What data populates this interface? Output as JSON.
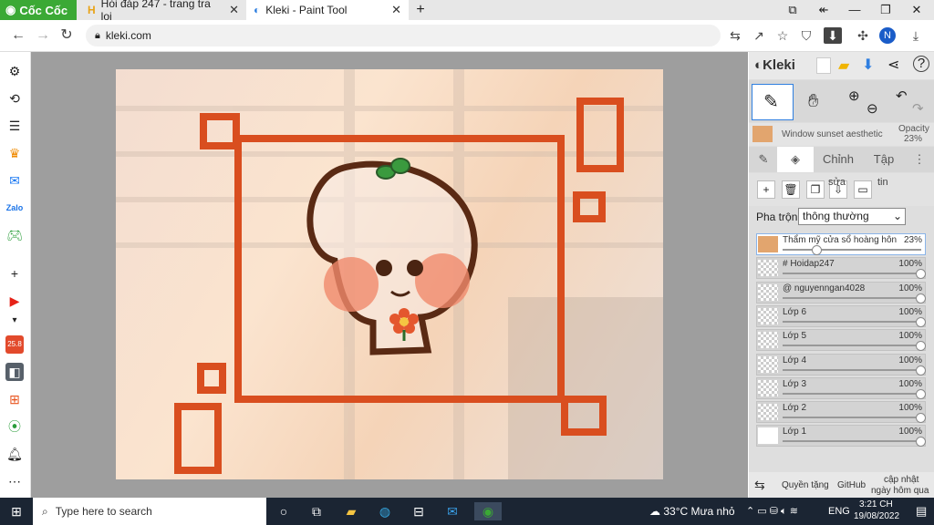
{
  "browser": {
    "brand": "Cốc Cốc",
    "tabs": [
      {
        "title": "Hỏi đáp 247 - trang tra loi"
      },
      {
        "title": "Kleki - Paint Tool"
      }
    ],
    "url": "kleki.com",
    "avatar_letter": "N"
  },
  "sidebar": {
    "badge": "25.8"
  },
  "kleki": {
    "logo": "Kleki",
    "brush_name": "Window sunset aesthetic",
    "opacity_label": "Opacity",
    "opacity_value": "23%",
    "tabs": [
      "Chỉnh",
      "Tập"
    ],
    "tab_extra_1": "sửa",
    "tab_extra_2": "tin",
    "blend_label": "Pha trộn",
    "blend_value": "thông thường",
    "layers": [
      {
        "name": "Thẩm mỹ cửa sổ hoàng hôn",
        "opacity": "23%",
        "level": 0.23
      },
      {
        "name": "# Hoidap247",
        "opacity": "100%",
        "level": 1
      },
      {
        "name": "@ nguyenngan4028",
        "opacity": "100%",
        "level": 1
      },
      {
        "name": "Lớp 6",
        "opacity": "100%",
        "level": 1
      },
      {
        "name": "Lớp 5",
        "opacity": "100%",
        "level": 1
      },
      {
        "name": "Lớp 4",
        "opacity": "100%",
        "level": 1
      },
      {
        "name": "Lớp 3",
        "opacity": "100%",
        "level": 1
      },
      {
        "name": "Lớp 2",
        "opacity": "100%",
        "level": 1
      },
      {
        "name": "Lớp 1",
        "opacity": "100%",
        "level": 1
      }
    ],
    "footer": {
      "privacy": "Quyền tặng",
      "github": "GitHub",
      "update_1": "cập nhật",
      "update_2": "ngày hôm qua"
    }
  },
  "taskbar": {
    "search_placeholder": "Type here to search",
    "weather": "33°C Mưa nhỏ",
    "lang": "ENG",
    "time": "3:21 CH",
    "date": "19/08/2022"
  },
  "colors": {
    "frame": "#d94e1f",
    "outline": "#5a2a14",
    "accent": "#2f7fe0",
    "brand_green": "#3ba935"
  }
}
